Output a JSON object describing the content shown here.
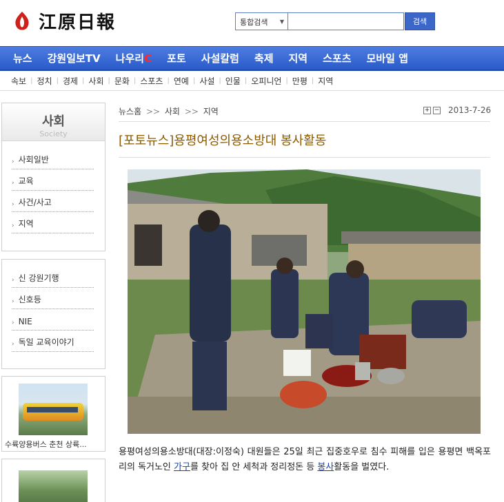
{
  "site": {
    "logo_text": "江原日報"
  },
  "search": {
    "scope": "통합검색",
    "button": "검색",
    "value": ""
  },
  "main_nav": [
    {
      "label": "뉴스"
    },
    {
      "label": "강원일보TV"
    },
    {
      "label": "나우리",
      "suffix": "C"
    },
    {
      "label": "포토"
    },
    {
      "label": "사설칼럼"
    },
    {
      "label": "축제"
    },
    {
      "label": "지역"
    },
    {
      "label": "스포츠"
    },
    {
      "label": "모바일 앱"
    }
  ],
  "sub_nav": [
    "속보",
    "정치",
    "경제",
    "사회",
    "문화",
    "스포츠",
    "연예",
    "사설",
    "인물",
    "오피니언",
    "만평",
    "지역"
  ],
  "sidebar": {
    "section_title": "사회",
    "section_title_en": "Society",
    "section_items": [
      "사회일반",
      "교육",
      "사건/사고",
      "지역"
    ],
    "extra_items": [
      "신 강원기행",
      "신호등",
      "NIE",
      "독일 교육이야기"
    ],
    "photo_caption": "수륙양용버스 춘천 상륙..."
  },
  "article": {
    "breadcrumb": [
      "뉴스홈",
      "사회",
      "지역"
    ],
    "breadcrumb_sep": ">>",
    "date": "2013-7-26",
    "title": "[포토뉴스]용평여성의용소방대 봉사활동",
    "body_1": "용평여성의용소방대(대장:이정숙) 대원들은 25일 최근 집중호우로 침수 피해를 입은 용평면 백옥포리의 독거노인 ",
    "link_1": "가구",
    "body_2": "를 찾아 집 안 세척과 정리정돈 등 ",
    "link_2": "봉사",
    "body_3": "활동을 벌였다."
  },
  "colors": {
    "nav_blue": "#3c66c8",
    "headline_brown": "#8a5a00",
    "logo_red": "#d0201a"
  }
}
